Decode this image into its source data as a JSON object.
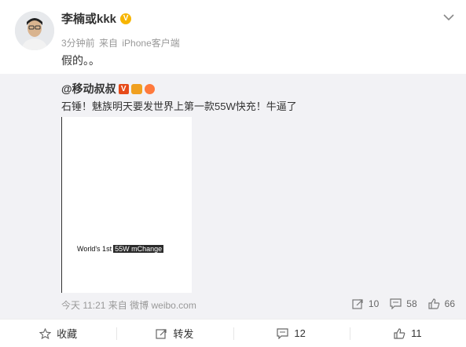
{
  "post": {
    "username": "李楠或kkk",
    "time": "3分钟前",
    "via_prefix": "来自",
    "device": "iPhone客户端",
    "text": "假的。。"
  },
  "repost": {
    "author": "@移动叔叔",
    "text": "石锤！魅族明天要发世界上第一款55W快充！牛逼了",
    "image_caption": {
      "prefix": "World's 1st",
      "highlight": "55W mChange"
    },
    "meta": "今天 11:21 来自 微博 weibo.com",
    "actions": {
      "share_count": "10",
      "comment_count": "58",
      "like_count": "66"
    }
  },
  "footer": {
    "favorite": "收藏",
    "repost": "转发",
    "comment": "12",
    "like": "11"
  },
  "colors": {
    "vip_badge": "#f7b500",
    "repost_bg": "#f2f2f5",
    "meta_gray": "#999999"
  }
}
